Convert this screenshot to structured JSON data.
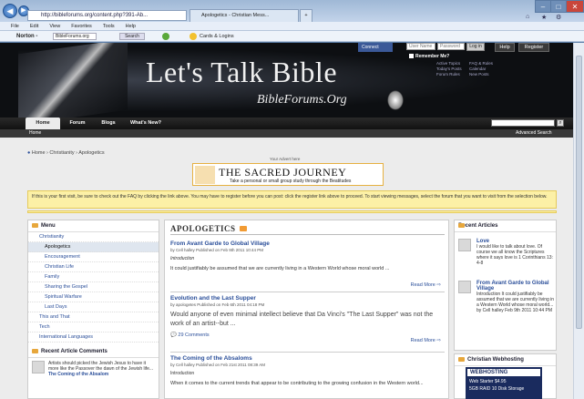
{
  "browser": {
    "url": "http://bibleforums.org/content.php?391-Ab...",
    "tab1_label": "Apologetics - Christian Mess...",
    "menu": [
      "File",
      "Edit",
      "View",
      "Favorites",
      "Tools",
      "Help"
    ],
    "norton": "Norton -",
    "norton_search": "BibleForums.org",
    "norton_search_btn": "Search",
    "cards_logins": "Cards & Logins"
  },
  "header": {
    "facebook_label": "Connect",
    "username_placeholder": "User Name",
    "password_placeholder": "Password",
    "login_label": "Log in",
    "help_label": "Help",
    "register_label": "Register",
    "remember_label": "Remember Me?",
    "links": [
      "Active Topics",
      "Today's Posts",
      "Forum Rules",
      "FAQ & Rules",
      "Calendar",
      "New Posts"
    ],
    "title": "Let's Talk Bible",
    "subtitle": "BibleForums.Org"
  },
  "nav": {
    "tabs": [
      "Home",
      "Forum",
      "Blogs",
      "What's New?"
    ],
    "sub_home": "Home",
    "advanced_search": "Advanced Search"
  },
  "breadcrumb": [
    "Home",
    "Christianity",
    "Apologetics"
  ],
  "ad": {
    "label": "Your Advert here",
    "title": "THE SACRED JOURNEY",
    "subtitle": "Take a personal or small group study through the Beatitudes"
  },
  "notice": "If this is your first visit, be sure to check out the FAQ by clicking the link above. You may have to register before you can post: click the register link above to proceed. To start viewing messages, select the forum that you want to visit from the selection below.",
  "menu_panel": {
    "title": "Menu",
    "items": [
      {
        "label": "Christianity",
        "level": "l1"
      },
      {
        "label": "Apologetics",
        "level": "l2",
        "selected": true
      },
      {
        "label": "Encouragement",
        "level": "l2"
      },
      {
        "label": "Christian Life",
        "level": "l2"
      },
      {
        "label": "Family",
        "level": "l2"
      },
      {
        "label": "Sharing the Gospel",
        "level": "l2"
      },
      {
        "label": "Spiritual Warfare",
        "level": "l2"
      },
      {
        "label": "Last Days",
        "level": "l2"
      },
      {
        "label": "This and That",
        "level": "l1"
      },
      {
        "label": "Tech",
        "level": "l1"
      },
      {
        "label": "International Languages",
        "level": "l1"
      }
    ]
  },
  "recent_comments": {
    "title": "Recent Article Comments",
    "text": "Artists should picked the Jewish Jesus to have it more like the Passover the dawn of the Jewish life...",
    "link": "The Coming of the Absalom"
  },
  "forum": {
    "title": "APOLOGETICS",
    "articles": [
      {
        "title": "From Avant Garde to Global Village",
        "meta": "by Cell halley Published on Feb 9th 2011 10:44 PM",
        "intro": "Introduction",
        "body": "It could justifiably be assumed that we are currently living in a Western World whose moral world ...",
        "more": "Read More"
      },
      {
        "title": "Evolution and the Last Supper",
        "meta": "by apologetes Published on Feb 6th 2011 04:18 PM",
        "body": "Would anyone of even minimal intellect believe that Da Vinci's \"The Last Supper\" was not the work of an artist--but ...",
        "comments": "29 Comments",
        "more": "Read More"
      },
      {
        "title": "The Coming of the Absaloms",
        "meta": "by Cell halley Published on Feb 21st 2011 08:39 AM",
        "intro": "Introduction",
        "body": "When it comes to the current trends that appear to be contributing to the growing confusion in the Western world..."
      }
    ]
  },
  "recent_articles": {
    "title": "Recent Articles",
    "items": [
      {
        "title": "Love",
        "text": "I would like to talk about love. Of course we all know the Scriptures where it says love is 1 Corinthians 13: 4-8"
      },
      {
        "title": "From Avant Garde to Global Village",
        "text": "Introduction It could justifiably be assumed that we are currently living in a Western World whose moral world... by Cell halley Feb 9th 2011 10:44 PM"
      }
    ]
  },
  "webhosting": {
    "title": "Christian Webhosting",
    "brand": "WEBHOSTING",
    "line1": "Web Starter $4.95",
    "line2": "5GB RAID 10 Disk Storage"
  },
  "colors": {
    "accent": "#2b4f9a",
    "notice": "#fcf0a6",
    "header": "#0d0f12",
    "rss": "#f29b33"
  }
}
